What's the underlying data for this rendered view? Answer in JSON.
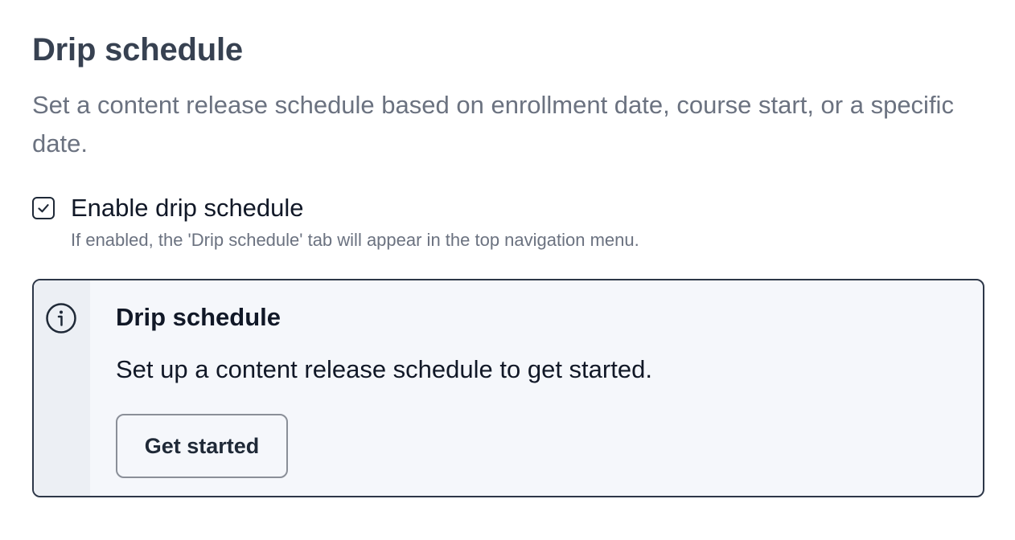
{
  "section": {
    "title": "Drip schedule",
    "description": "Set a content release schedule based on enrollment date, course start, or a specific date."
  },
  "enable_drip": {
    "label": "Enable drip schedule",
    "checked": true,
    "hint": "If enabled, the 'Drip schedule' tab will appear in the top navigation menu."
  },
  "info_alert": {
    "icon": "info-icon",
    "title": "Drip schedule",
    "text": "Set up a content release schedule to get started.",
    "button_label": "Get started"
  },
  "colors": {
    "title": "#374151",
    "description": "#6b7280",
    "alert_border": "#2d3748",
    "alert_background": "#f5f7fb",
    "alert_gutter": "#eceff4"
  }
}
